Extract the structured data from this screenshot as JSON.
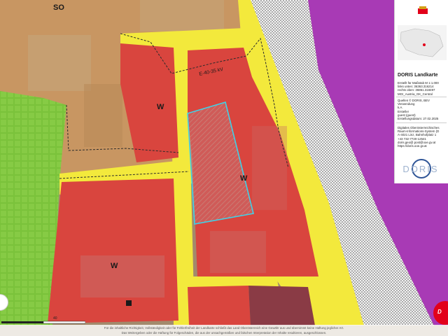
{
  "map": {
    "zones": {
      "so_label": "SO",
      "w_labels": [
        "W",
        "W",
        "W"
      ],
      "colors": {
        "brown_zone": "#c89662",
        "red_zone": "#d9453e",
        "yellow_road": "#f3e93c",
        "green_zone": "#7bc23a",
        "purple_zone": "#a83ab5",
        "dotted_rail": "#f2f2f2",
        "parcel_outline": "#3fd2e8",
        "dark_red_zone": "#8a3b45"
      }
    },
    "power_line_label": "E-40-35 kV"
  },
  "panel": {
    "title": "DORIS Landkarte",
    "meta": [
      "Erstellt für Maßstab M 1:1.000",
      "links unten: 36363.316214",
      "rechts oben: 36861.318497",
      "MGI_Austria_GK_Central"
    ],
    "sources": [
      "Quellen © DORIS, BEV",
      "Verwendung",
      "k.A.",
      "Ersteller",
      "guest (guest)",
      "Erstellungsdatum: 27.02.2025"
    ],
    "contact": [
      "Digitales Oberösterreichisches",
      "Raum-Informations-System (D",
      "A-4021 Linz, Bahnhofplatz 1",
      "+43 732-7720-12541",
      "doris.geo@.post@ooe.gv.at",
      "https://doris.ooe.gv.at"
    ],
    "logo_text": "DORIS"
  },
  "scale": {
    "label": "40"
  },
  "footer": {
    "line1": "Für die inhaltliche Richtigkeit, Vollständigkeit oder für Fehlerfreiheit der Landkarte schließt das Land Oberösterreich eine Gewähr aus und übernimmt keine Haftung jeglicher Art.",
    "line2": "Das Weitergeben oder die Haftung für Folgeschäden, die aus der unsachgemäßen und falschen Interpretation der Inhalte resultieren, ausgeschlossen."
  },
  "badge": {
    "label": "D"
  }
}
